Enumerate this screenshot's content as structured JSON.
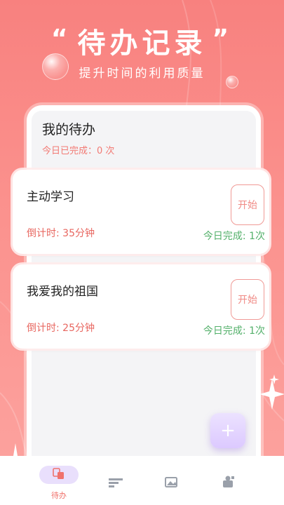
{
  "header": {
    "title": "待办记录",
    "quote_left": "“",
    "quote_right": "”",
    "subtitle": "提升时间的利用质量"
  },
  "panel": {
    "title": "我的待办",
    "today_completed": "今日已完成：0 次"
  },
  "tasks": [
    {
      "name": "主动学习",
      "countdown": "倒计时: 35分钟",
      "button": "开始",
      "today_done": "今日完成: 1次"
    },
    {
      "name": "我爱我的祖国",
      "countdown": "倒计时: 25分钟",
      "button": "开始",
      "today_done": "今日完成: 1次"
    }
  ],
  "fab": {
    "label": "+"
  },
  "tabbar": {
    "tabs": [
      {
        "label": "待办",
        "icon": "todo-icon",
        "active": true
      },
      {
        "label": "",
        "icon": "list-icon",
        "active": false
      },
      {
        "label": "",
        "icon": "image-icon",
        "active": false
      },
      {
        "label": "",
        "icon": "profile-icon",
        "active": false
      }
    ]
  },
  "colors": {
    "background": "#f8817f",
    "accent_red": "#e8665f",
    "success_green": "#53b06a",
    "fab_purple": "#dcc9ff"
  }
}
